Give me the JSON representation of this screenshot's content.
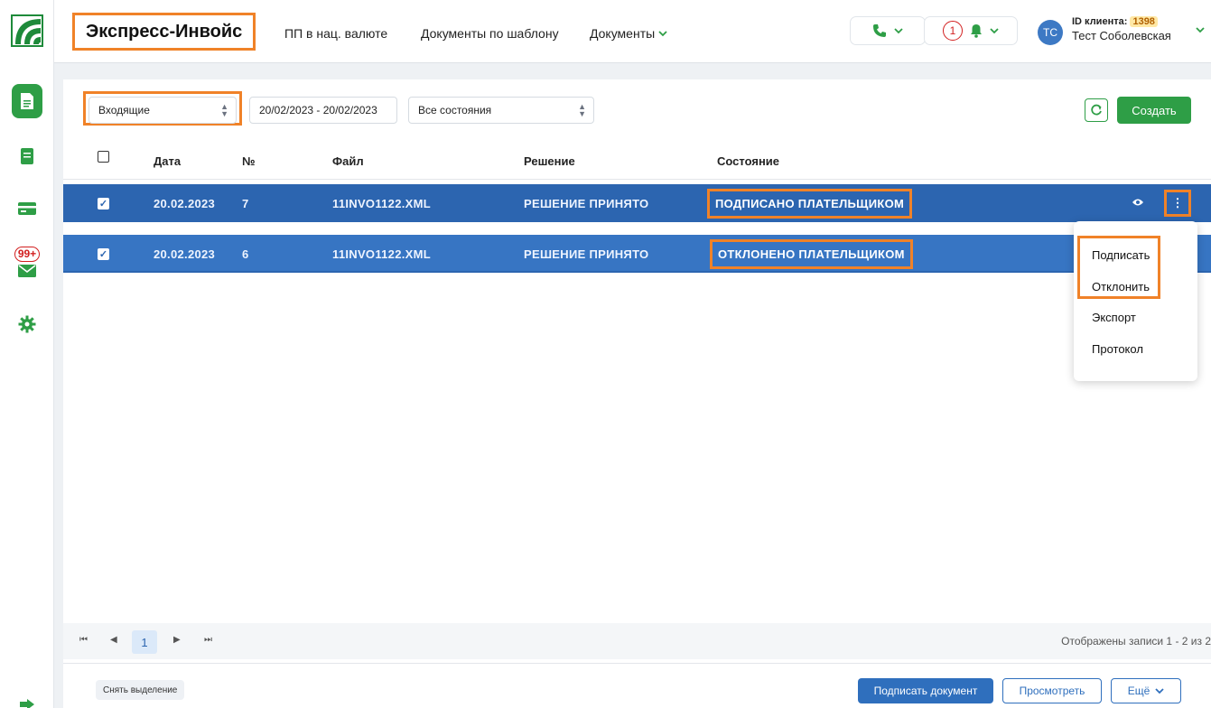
{
  "sidebar": {
    "icons": [
      "logo-icon",
      "document-icon",
      "book-icon",
      "card-icon",
      "mail-icon",
      "gear-icon",
      "logout-icon"
    ],
    "mail_badge": "99+"
  },
  "header": {
    "app_title": "Экспресс-Инвойс",
    "nav": [
      "ПП в нац. валюте",
      "Документы по шаблону",
      "Документы"
    ],
    "notification_count": "1",
    "avatar_initials": "ТС",
    "client_id_label": "ID клиента:",
    "client_id_value": "1398",
    "user_name": "Тест Соболевская"
  },
  "filters": {
    "direction": "Входящие",
    "date_range": "20/02/2023 - 20/02/2023",
    "state": "Все состояния",
    "create_label": "Создать"
  },
  "table": {
    "columns": [
      "Дата",
      "№",
      "Файл",
      "Решение",
      "Состояние"
    ],
    "rows": [
      {
        "date": "20.02.2023",
        "num": "7",
        "file": "11INVO1122.XML",
        "decision": "РЕШЕНИЕ ПРИНЯТО",
        "state": "ПОДПИСАНО ПЛАТЕЛЬЩИКОМ",
        "selected": true
      },
      {
        "date": "20.02.2023",
        "num": "6",
        "file": "11INVO1122.XML",
        "decision": "РЕШЕНИЕ ПРИНЯТО",
        "state": "ОТКЛОНЕНО ПЛАТЕЛЬЩИКОМ",
        "selected": true
      }
    ]
  },
  "context_menu": {
    "items": [
      "Подписать",
      "Отклонить",
      "Экспорт",
      "Протокол"
    ]
  },
  "pager": {
    "current_page": "1",
    "info": "Отображены записи 1 - 2 из 2"
  },
  "footer": {
    "deselect": "Снять выделение",
    "sign_document": "Подписать документ",
    "view": "Просмотреть",
    "more": "Ещё"
  },
  "colors": {
    "brand_green": "#2e9e46",
    "row_blue": "#2c65b0",
    "highlight_orange": "#f08228"
  }
}
